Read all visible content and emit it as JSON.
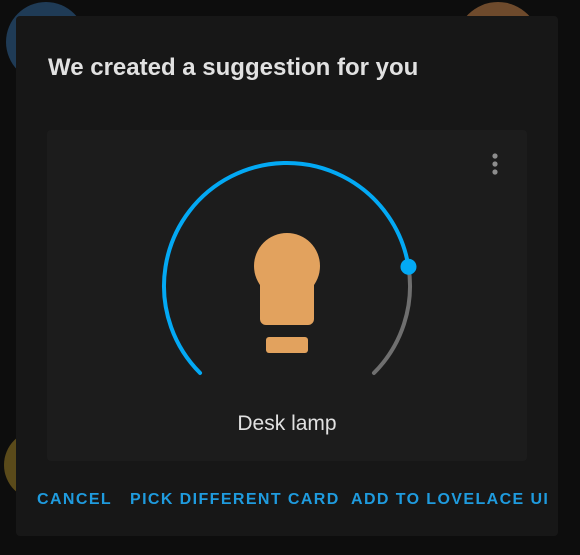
{
  "dialog": {
    "title": "We created a suggestion for you"
  },
  "card": {
    "entity_name": "Desk lamp",
    "brightness_fraction": 0.8,
    "state": "on"
  },
  "actions": {
    "cancel": "CANCEL",
    "pick_different": "PICK DIFFERENT CARD",
    "add": "ADD TO LOVELACE UI"
  },
  "colors": {
    "accent": "#03a9f4",
    "bulb": "#e2a25e",
    "track": "#6f6f6f"
  },
  "icons": {
    "menu": "dots-vertical-icon",
    "bulb": "lightbulb-icon"
  }
}
